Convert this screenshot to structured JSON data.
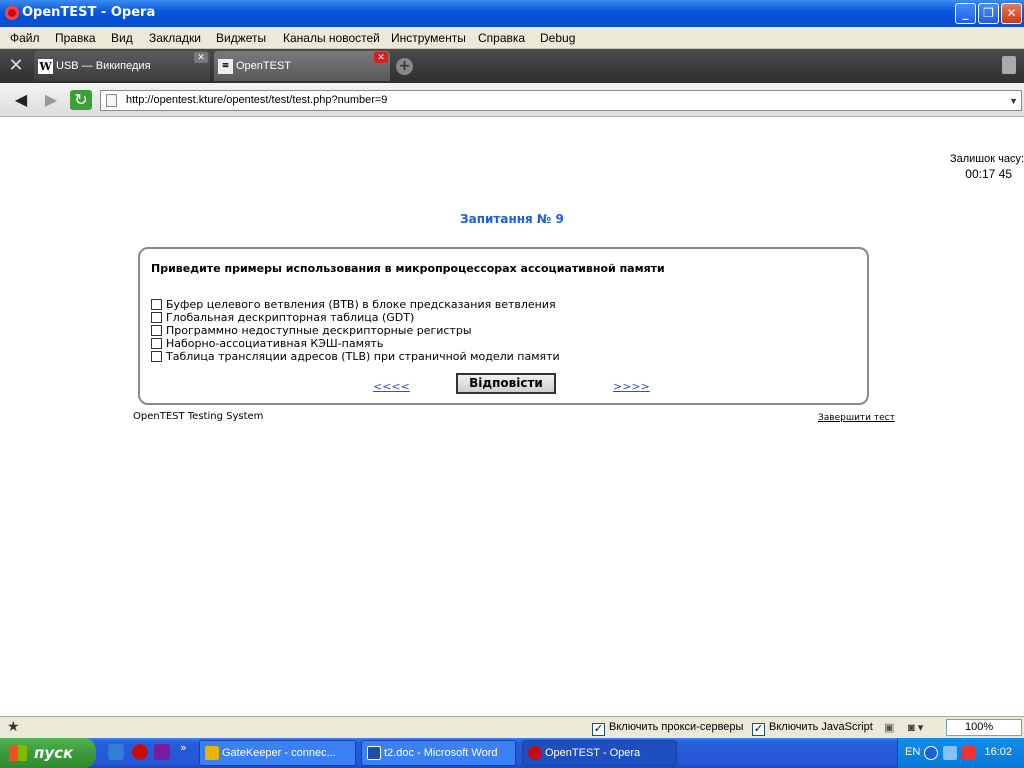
{
  "window": {
    "title": "OpenTEST - Opera"
  },
  "menu": [
    "Файл",
    "Правка",
    "Вид",
    "Закладки",
    "Виджеты",
    "Каналы новостей",
    "Инструменты",
    "Справка",
    "Debug"
  ],
  "tabs": [
    {
      "label": "USB — Википедия",
      "icon": "W"
    },
    {
      "label": "OpenTEST"
    }
  ],
  "address": {
    "url": "http://opentest.kture/opentest/test/test.php?number=9"
  },
  "page": {
    "timer_label": "Залишок часу:",
    "timer_value": "00:17 45",
    "question_title": "Запитання № 9",
    "question_text": "Приведите примеры использования в микропроцессорах ассоциативной памяти",
    "options": [
      "Буфер целевого ветвления (BTB) в блоке предсказания ветвления",
      "Глобальная дескрипторная таблица (GDT)",
      "Программно недоступные дескрипторные регистры",
      "Наборно-ассоциативная КЭШ-память",
      "Таблица трансляции адресов (TLB) при страничной модели памяти"
    ],
    "prev_link": "<<<<",
    "next_link": ">>>>",
    "answer_button": "Відповісти",
    "footer_left": "OpenTEST Testing System",
    "footer_right": "Завершити тест"
  },
  "statusbar": {
    "proxy": "Включить прокси-серверы",
    "javascript": "Включить JavaScript",
    "zoom": "100%"
  },
  "taskbar": {
    "start": "пуск",
    "tasks": [
      "GateKeeper - connec...",
      "t2.doc - Microsoft Word",
      "OpenTEST - Opera"
    ],
    "lang": "EN",
    "clock": "16:02"
  }
}
